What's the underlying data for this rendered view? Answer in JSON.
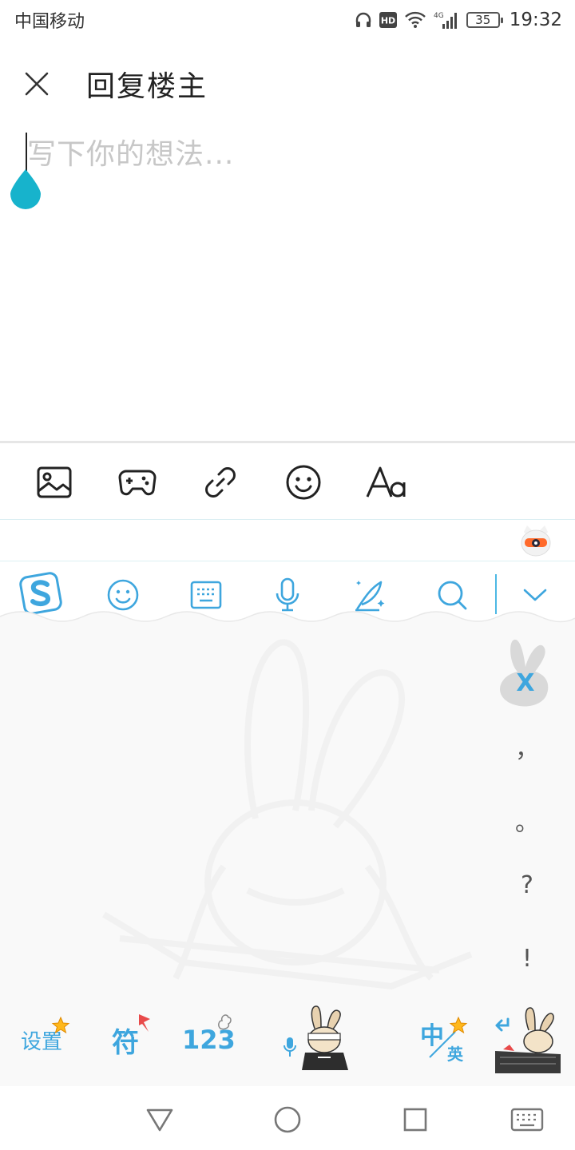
{
  "status_bar": {
    "carrier": "中国移动",
    "net_type": "4G",
    "battery": "35",
    "time": "19:32"
  },
  "header": {
    "title": "回复楼主",
    "close_icon": "close-icon"
  },
  "editor": {
    "placeholder": "写下你的想法..."
  },
  "format_toolbar": {
    "items": [
      "image-icon",
      "gamepad-icon",
      "link-icon",
      "emoji-icon",
      "text-format-icon"
    ]
  },
  "ime_toolbar": {
    "items": [
      "sogou-logo-icon",
      "emoji-icon",
      "keyboard-icon",
      "microphone-icon",
      "handwriting-icon",
      "search-icon",
      "collapse-chevron-icon"
    ],
    "accent_color": "#3ea6de"
  },
  "keyboard": {
    "delete_label": "X",
    "punctuation": [
      "，",
      "。",
      "?",
      "!"
    ],
    "bottom_row": {
      "settings_label": "设置",
      "symbols_label": "符",
      "numbers_label": "123",
      "lang_main": "中",
      "lang_alt": "英"
    }
  },
  "nav_bar": {
    "items": [
      "back-triangle-icon",
      "home-circle-icon",
      "recents-square-icon",
      "keyboard-toggle-icon"
    ]
  }
}
